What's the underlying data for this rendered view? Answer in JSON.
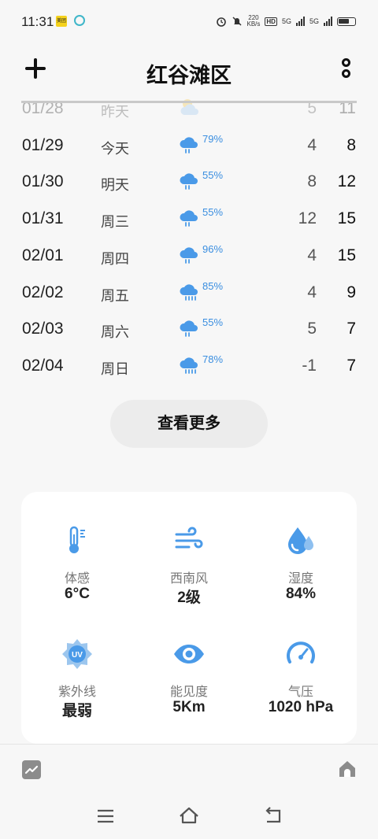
{
  "status_bar": {
    "time": "11:31",
    "badge": "美团",
    "speed_value": "220",
    "speed_unit": "KB/s",
    "hd": "HD",
    "sim1": "5G",
    "sim2": "5G"
  },
  "header": {
    "title": "红谷滩区"
  },
  "forecast": [
    {
      "date": "01/28",
      "day": "昨天",
      "icon": "partly-cloudy-icon",
      "pop": "",
      "low": "5",
      "high": "11",
      "faded": true
    },
    {
      "date": "01/29",
      "day": "今天",
      "icon": "rain-icon",
      "pop": "79%",
      "low": "4",
      "high": "8"
    },
    {
      "date": "01/30",
      "day": "明天",
      "icon": "rain-icon",
      "pop": "55%",
      "low": "8",
      "high": "12"
    },
    {
      "date": "01/31",
      "day": "周三",
      "icon": "rain-icon",
      "pop": "55%",
      "low": "12",
      "high": "15"
    },
    {
      "date": "02/01",
      "day": "周四",
      "icon": "rain-icon",
      "pop": "96%",
      "low": "4",
      "high": "15"
    },
    {
      "date": "02/02",
      "day": "周五",
      "icon": "heavy-rain-icon",
      "pop": "85%",
      "low": "4",
      "high": "9"
    },
    {
      "date": "02/03",
      "day": "周六",
      "icon": "rain-icon",
      "pop": "55%",
      "low": "5",
      "high": "7"
    },
    {
      "date": "02/04",
      "day": "周日",
      "icon": "heavy-rain-icon",
      "pop": "78%",
      "low": "-1",
      "high": "7"
    }
  ],
  "see_more_label": "查看更多",
  "details": [
    {
      "icon": "thermometer-icon",
      "label": "体感",
      "value": "6°C"
    },
    {
      "icon": "wind-icon",
      "label": "西南风",
      "value": "2级"
    },
    {
      "icon": "humidity-icon",
      "label": "湿度",
      "value": "84%"
    },
    {
      "icon": "uv-icon",
      "label": "紫外线",
      "value": "最弱"
    },
    {
      "icon": "eye-icon",
      "label": "能见度",
      "value": "5Km"
    },
    {
      "icon": "pressure-gauge-icon",
      "label": "气压",
      "value": "1020 hPa"
    }
  ],
  "colors": {
    "accent_blue": "#3a8ee0",
    "icon_blue": "#4a9ae8",
    "background": "#f7f7f7"
  }
}
